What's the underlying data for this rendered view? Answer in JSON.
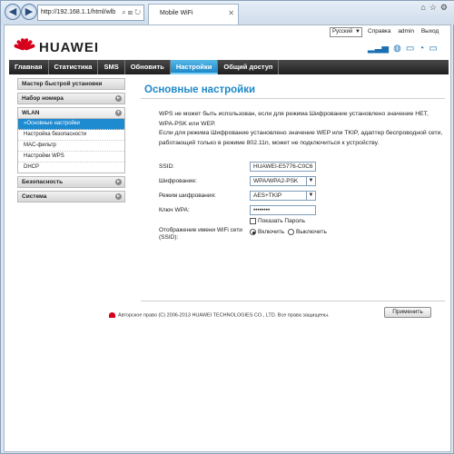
{
  "browser": {
    "address": "http://192.168.1.1/html/wlb",
    "tab_title": "Mobile WiFi"
  },
  "header": {
    "language": "Русский",
    "links": [
      "Справка",
      "admin",
      "Выход"
    ],
    "logo_text": "HUAWEI",
    "brand_color": "#d6001c"
  },
  "menu": {
    "items": [
      "Главная",
      "Статистика",
      "SMS",
      "Обновить",
      "Настройки",
      "Общий доступ"
    ],
    "active": "Настройки",
    "accent": "#1e88c8"
  },
  "sidebar": {
    "quick_setup": "Мастер быстрой установки",
    "dial": "Набор номера",
    "wlan": "WLAN",
    "wlan_items": [
      "»Основные настройки",
      "Настройка безопасности",
      "MAC-фильтр",
      "Настройки WPS",
      "DHCP"
    ],
    "security": "Безопасность",
    "system": "Система"
  },
  "content": {
    "title": "Основные настройки",
    "note1": "WPS не может быть использован, если для режима Шифрование установлено значение НЕТ, WPA-PSK или WEP.",
    "note2": "Если для режима Шифрование установлено значение WEP или TKIP, адаптер беспроводной сети, работающий только в режиме 802.11n, может не подключиться к устройству.",
    "ssid_label": "SSID:",
    "ssid_value": "HUAWEI-E5776-C0C6",
    "encryption_label": "Шифрование:",
    "encryption_value": "WPA/WPA2-PSK",
    "mode_label": "Режим шифрования:",
    "mode_value": "AES+TKIP",
    "key_label": "Ключ WPA:",
    "key_value": "••••••••",
    "show_password": "Показать Пароль",
    "ssid_broadcast_label1": "Отображение имени WiFi сети",
    "ssid_broadcast_label2": "(SSID):",
    "on_label": "Включить",
    "off_label": "Выключить",
    "apply": "Применить"
  },
  "footer": {
    "copyright": "Авторское право (C) 2006-2013 HUAWEI TECHNOLOGIES CO., LTD. Все права защищены."
  }
}
